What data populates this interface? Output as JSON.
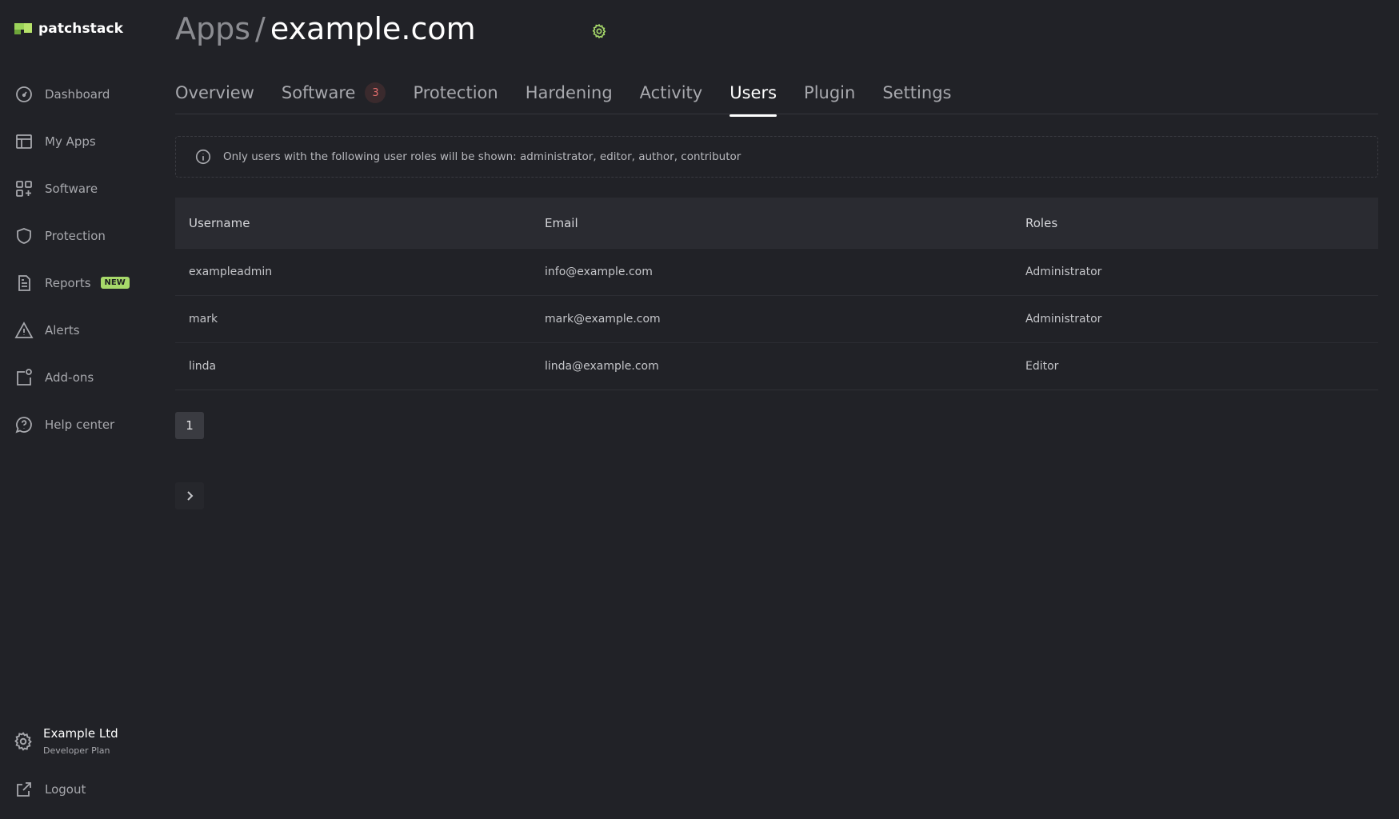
{
  "brand": {
    "name": "patchstack"
  },
  "sidebar": {
    "items": [
      {
        "label": "Dashboard",
        "icon": "dashboard-icon"
      },
      {
        "label": "My Apps",
        "icon": "apps-icon"
      },
      {
        "label": "Software",
        "icon": "software-icon"
      },
      {
        "label": "Protection",
        "icon": "shield-icon"
      },
      {
        "label": "Reports",
        "icon": "report-icon",
        "badge": "NEW"
      },
      {
        "label": "Alerts",
        "icon": "alert-icon"
      },
      {
        "label": "Add-ons",
        "icon": "addons-icon"
      },
      {
        "label": "Help center",
        "icon": "help-icon"
      }
    ],
    "account": {
      "name": "Example Ltd",
      "plan": "Developer Plan"
    },
    "logout": "Logout"
  },
  "header": {
    "crumb": "Apps",
    "separator": "/",
    "site": "example.com"
  },
  "tabs": [
    {
      "label": "Overview"
    },
    {
      "label": "Software",
      "count": "3"
    },
    {
      "label": "Protection"
    },
    {
      "label": "Hardening"
    },
    {
      "label": "Activity"
    },
    {
      "label": "Users",
      "active": true
    },
    {
      "label": "Plugin"
    },
    {
      "label": "Settings"
    }
  ],
  "notice": "Only users with the following user roles will be shown: administrator, editor, author, contributor",
  "table": {
    "columns": [
      "Username",
      "Email",
      "Roles"
    ],
    "rows": [
      [
        "exampleadmin",
        "info@example.com",
        "Administrator"
      ],
      [
        "mark",
        "mark@example.com",
        "Administrator"
      ],
      [
        "linda",
        "linda@example.com",
        "Editor"
      ]
    ]
  },
  "pagination": {
    "current": "1"
  },
  "colors": {
    "accent": "#a7d96a",
    "background": "#212227",
    "danger": "#e26d6d"
  }
}
